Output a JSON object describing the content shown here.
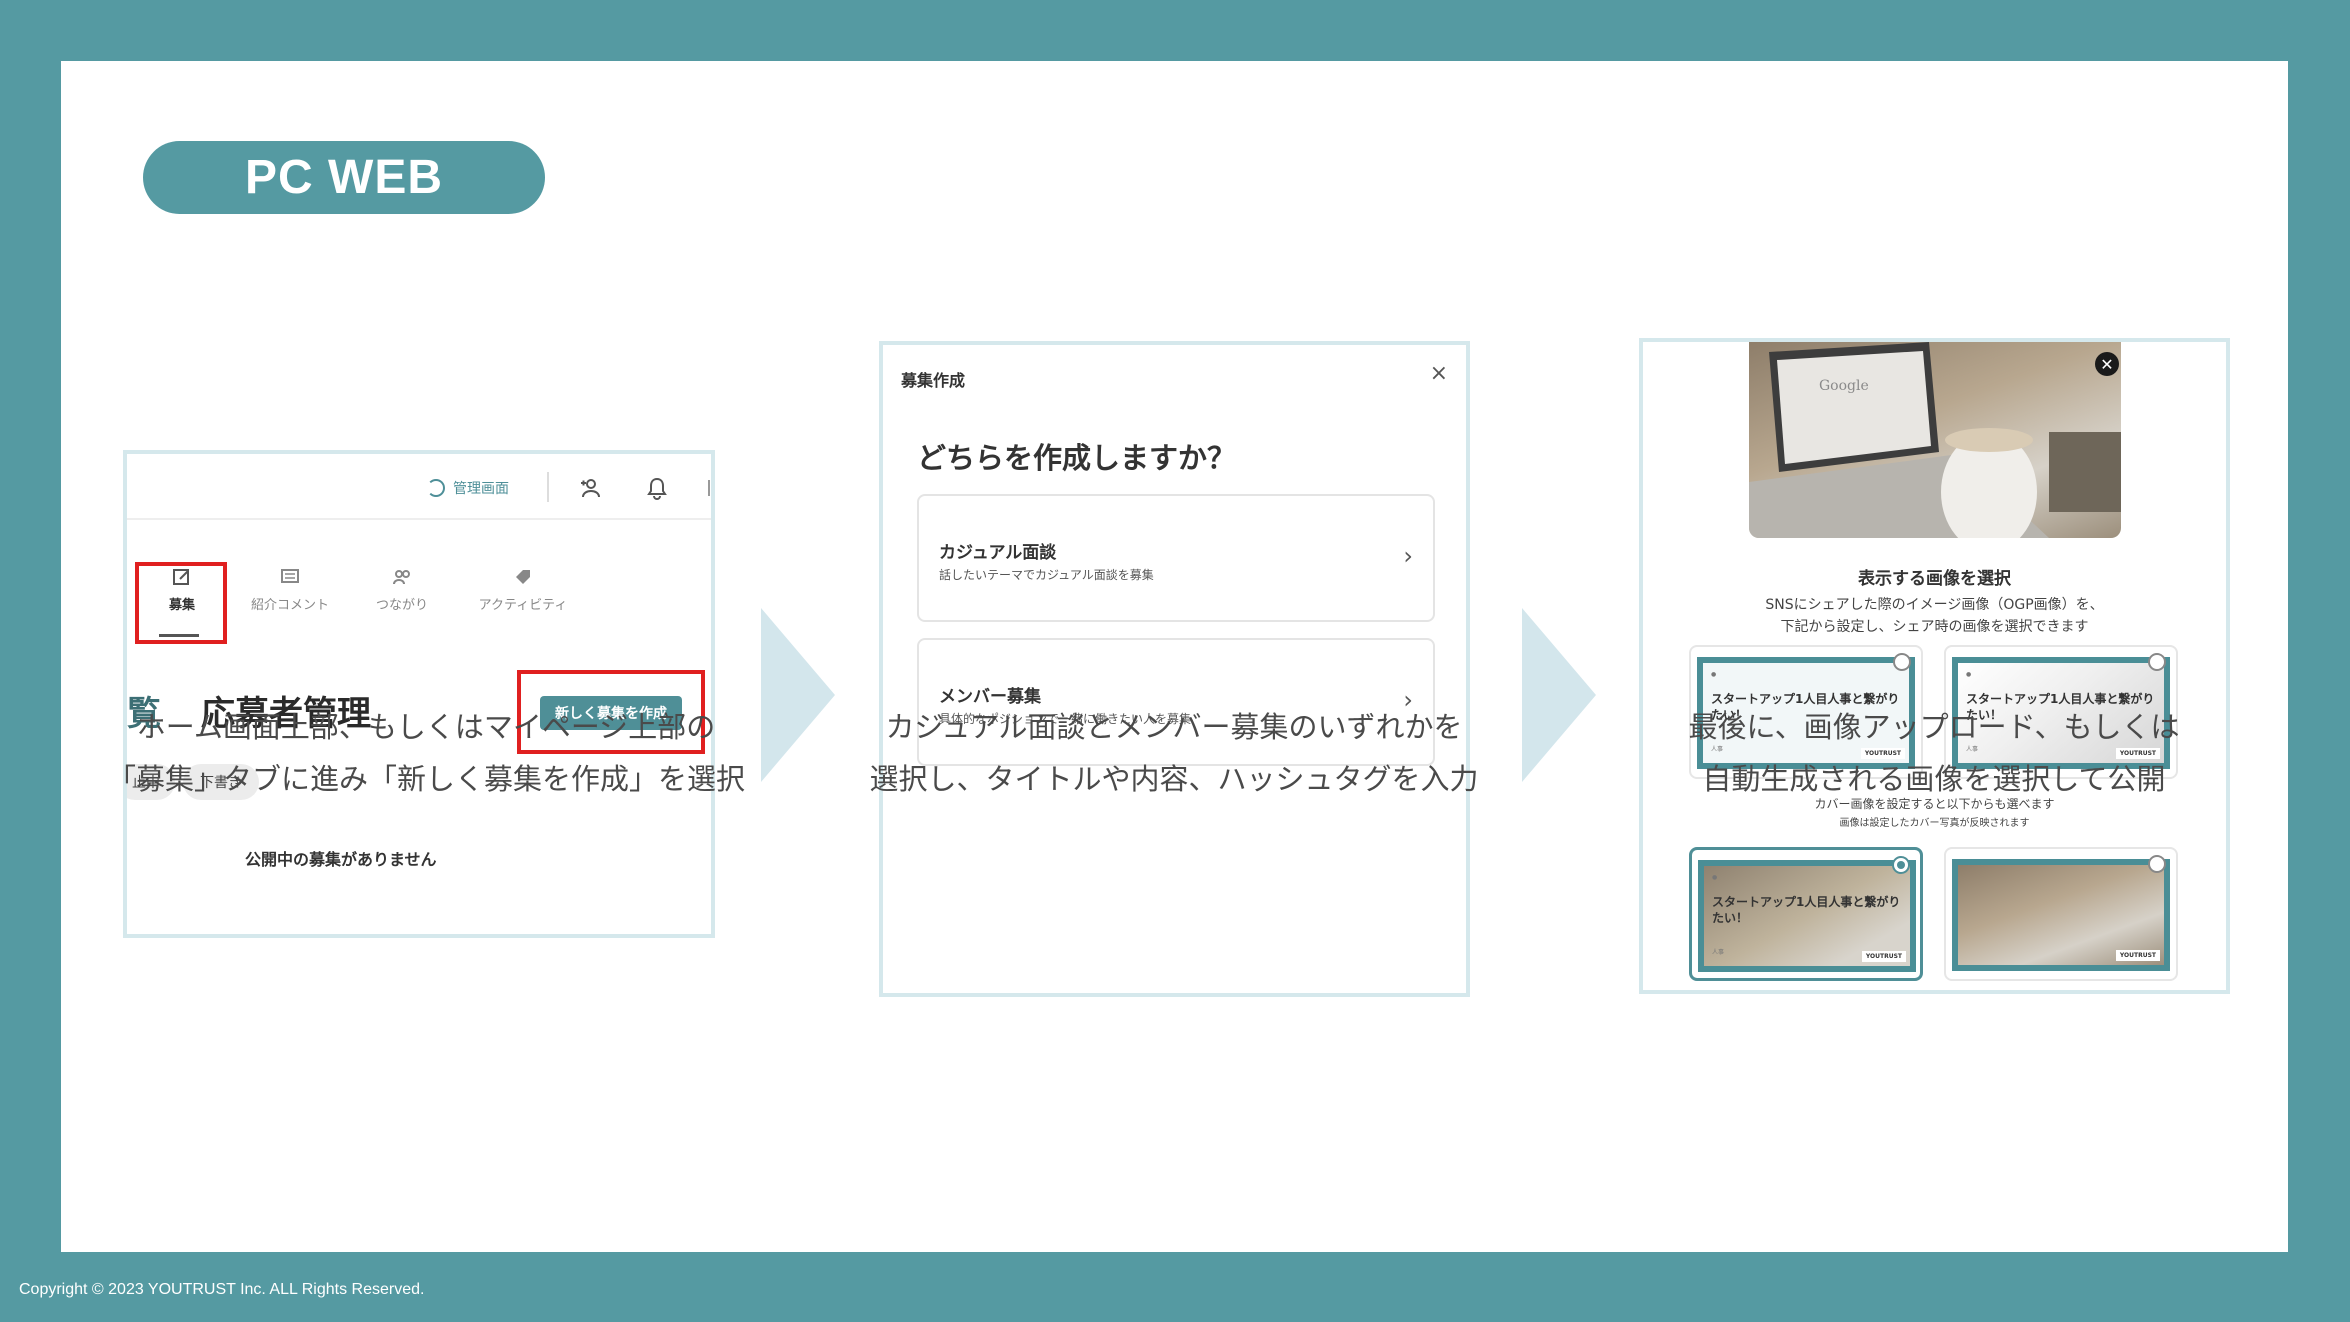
{
  "badge": "PC WEB",
  "footer": "Copyright © 2023 YOUTRUST Inc. ALL Rights Reserved.",
  "colors": {
    "frame": "#559aa2",
    "accent": "#4f8f97",
    "highlight": "#e02020",
    "arrow": "#d3e6ec"
  },
  "panel1": {
    "admin_label": "管理画面",
    "tabs": [
      {
        "label": "募集",
        "icon": "edit-icon",
        "active": true
      },
      {
        "label": "紹介コメント",
        "icon": "comment-icon"
      },
      {
        "label": "つながり",
        "icon": "people-icon"
      },
      {
        "label": "アクティビティ",
        "icon": "tag-icon"
      }
    ],
    "heading_cut": "覧",
    "heading": "応募者管理",
    "new_button": "新しく募集を作成",
    "chips": [
      "止中",
      "下書き"
    ],
    "empty": "公開中の募集がありません",
    "caption_line1": "ホーム画面上部、もしくはマイページ上部の",
    "caption_line2": "「募集」タブに進み「新しく募集を作成」を選択"
  },
  "panel2": {
    "dialog_title": "募集作成",
    "close": "×",
    "question": "どちらを作成しますか？",
    "options": [
      {
        "title": "カジュアル面談",
        "desc": "話したいテーマでカジュアル面談を募集"
      },
      {
        "title": "メンバー募集",
        "desc": "具体的なポジションで一緒に働きたい人を募集"
      }
    ],
    "chevron": "›",
    "caption_line1": "カジュアル面談とメンバー募集のいずれかを",
    "caption_line2": "選択し、タイトルや内容、ハッシュタグを入力"
  },
  "panel3": {
    "photo_text": "Google",
    "close": "✕",
    "heading": "表示する画像を選択",
    "sub1": "SNSにシェアした際のイメージ画像（OGP画像）を、",
    "sub2": "下記から設定し、シェア時の画像を選択できます",
    "mid1": "カバー画像を設定すると以下からも選べます",
    "mid2": "画像は設定したカバー写真が反映されます",
    "ogp_title": "スタートアップ1人目人事と繋がりたい！",
    "ogp_brand": "YOUTRUST",
    "caption_line1": "最後に、画像アップロード、もしくは",
    "caption_line2": "自動生成される画像を選択して公開"
  }
}
